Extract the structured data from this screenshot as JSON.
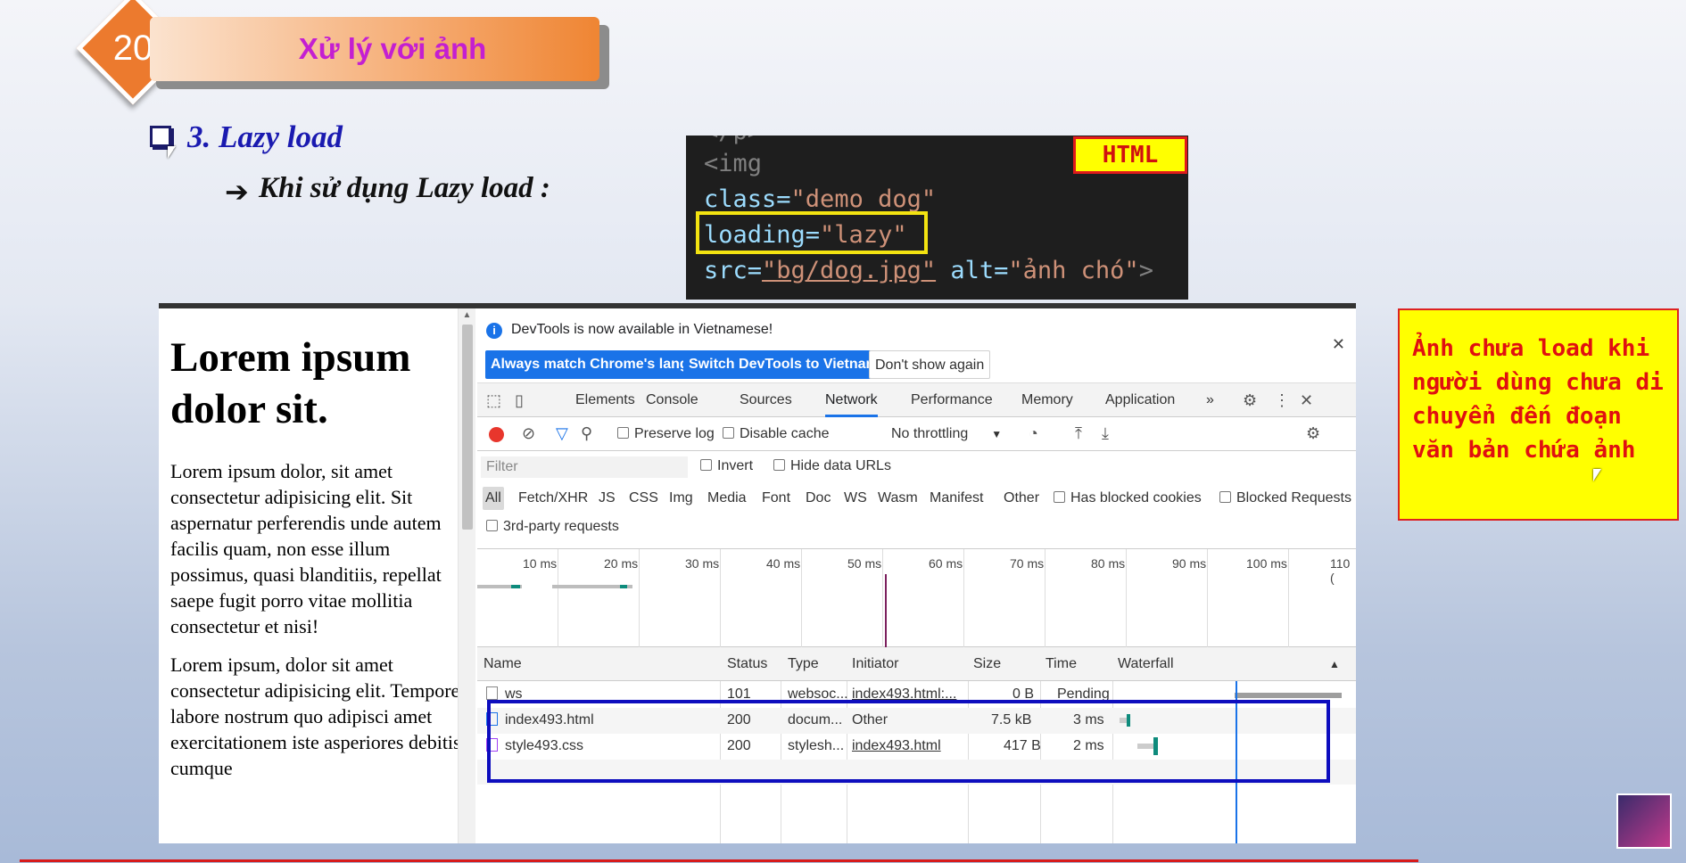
{
  "slide": {
    "number": "20",
    "title": "Xử lý với ảnh",
    "heading": "3. Lazy load",
    "subheading": "Khi sử dụng Lazy load :"
  },
  "code": {
    "line0": "</p>",
    "line1_tag": "<img",
    "line2_attr": "class=",
    "line2_val": "\"demo dog\"",
    "line3_attr": "loading=",
    "line3_val": "\"lazy\"",
    "line4_attr": "src=",
    "line4_val": "\"bg/dog.jpg\"",
    "line4_attr2": " alt=",
    "line4_val2": "\"ảnh chó\"",
    "line4_end": ">",
    "badge": "HTML"
  },
  "page": {
    "heading": "Lorem ipsum dolor sit.",
    "para1": "Lorem ipsum dolor, sit amet consectetur adipisicing elit. Sit aspernatur perferendis unde autem facilis quam, non esse illum possimus, quasi blanditiis, repellat saepe fugit porro vitae mollitia consectetur et nisi!",
    "para2": "Lorem ipsum, dolor sit amet consectetur adipisicing elit. Tempore labore nostrum quo adipisci amet exercitationem iste asperiores debitis cumque"
  },
  "devtools": {
    "info": "DevTools is now available in Vietnamese!",
    "btn_match": "Always match Chrome's language",
    "btn_switch": "Switch DevTools to Vietnamese",
    "btn_dont": "Don't show again",
    "tabs": [
      "Elements",
      "Console",
      "Sources",
      "Network",
      "Performance",
      "Memory",
      "Application"
    ],
    "more": "»",
    "preserve_log": "Preserve log",
    "disable_cache": "Disable cache",
    "throttling": "No throttling",
    "filter_placeholder": "Filter",
    "invert": "Invert",
    "hide_data_urls": "Hide data URLs",
    "types": [
      "All",
      "Fetch/XHR",
      "JS",
      "CSS",
      "Img",
      "Media",
      "Font",
      "Doc",
      "WS",
      "Wasm",
      "Manifest",
      "Other"
    ],
    "has_blocked_cookies": "Has blocked cookies",
    "blocked_requests": "Blocked Requests",
    "third_party": "3rd-party requests",
    "ticks": [
      "10 ms",
      "20 ms",
      "30 ms",
      "40 ms",
      "50 ms",
      "60 ms",
      "70 ms",
      "80 ms",
      "90 ms",
      "100 ms",
      "110 ("
    ],
    "columns": {
      "name": "Name",
      "status": "Status",
      "type": "Type",
      "initiator": "Initiator",
      "size": "Size",
      "time": "Time",
      "waterfall": "Waterfall"
    },
    "rows": [
      {
        "name": "ws",
        "status": "101",
        "type": "websoc...",
        "initiator": "index493.html:...",
        "size": "0 B",
        "time": "Pending"
      },
      {
        "name": "index493.html",
        "status": "200",
        "type": "docum...",
        "initiator": "Other",
        "size": "7.5 kB",
        "time": "3 ms"
      },
      {
        "name": "style493.css",
        "status": "200",
        "type": "stylesh...",
        "initiator": "index493.html",
        "size": "417 B",
        "time": "2 ms"
      }
    ]
  },
  "callout": {
    "text": "Ảnh chưa load khi người dùng chưa di chuyển đến đoạn văn bản chứa ảnh"
  },
  "colors": {
    "accent_orange": "#ec7a2e",
    "title_text": "#c41fd1",
    "heading_blue": "#1a1ab0",
    "callout_bg": "#ffff00",
    "callout_text": "#e01010",
    "highlight_blue": "#0d0dbe",
    "devtools_blue": "#1a73e8"
  }
}
